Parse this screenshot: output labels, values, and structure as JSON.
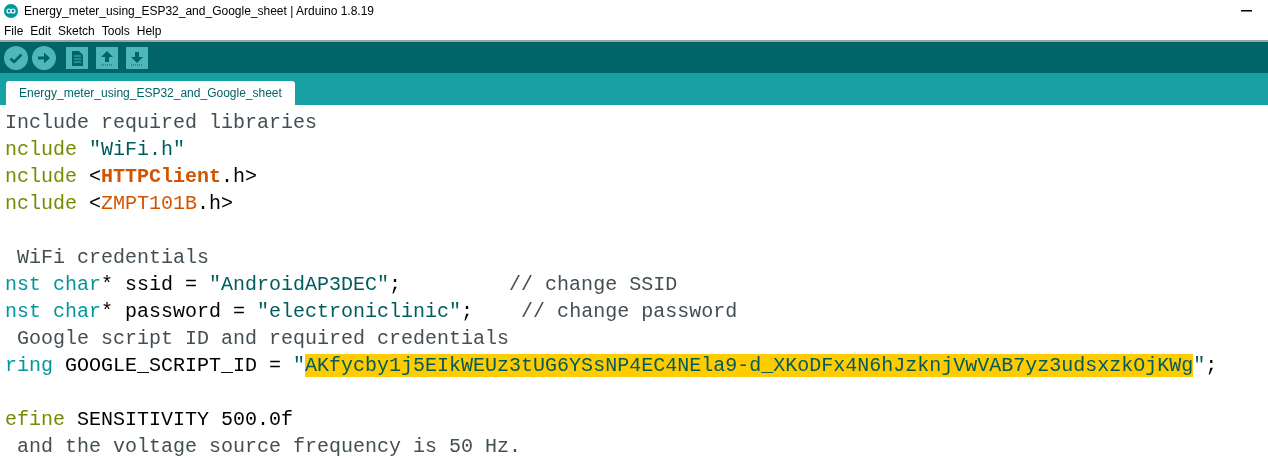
{
  "window": {
    "title": "Energy_meter_using_ESP32_and_Google_sheet | Arduino 1.8.19"
  },
  "menu": [
    "File",
    "Edit",
    "Sketch",
    "Tools",
    "Help"
  ],
  "toolbar": [
    {
      "kind": "verify"
    },
    {
      "kind": "upload"
    },
    {
      "kind": "new"
    },
    {
      "kind": "open"
    },
    {
      "kind": "save"
    }
  ],
  "tabs": [
    {
      "label": "Energy_meter_using_ESP32_and_Google_sheet",
      "selected": true
    }
  ],
  "editor": {
    "lines": [
      {
        "kind": "code",
        "tokens": [
          {
            "kind": "comment",
            "text": "Include required libraries"
          }
        ]
      },
      {
        "kind": "code",
        "tokens": [
          {
            "kind": "directive",
            "text": "nclude"
          },
          {
            "kind": "string",
            "text": " \"WiFi.h\""
          }
        ]
      },
      {
        "kind": "code",
        "tokens": [
          {
            "kind": "directive",
            "text": "nclude"
          },
          {
            "kind": "plain",
            "text": " <"
          },
          {
            "kind": "library_bold",
            "text": "HTTPClient"
          },
          {
            "kind": "plain",
            "text": ".h>"
          }
        ]
      },
      {
        "kind": "code",
        "tokens": [
          {
            "kind": "directive",
            "text": "nclude"
          },
          {
            "kind": "plain",
            "text": " <"
          },
          {
            "kind": "library",
            "text": "ZMPT101B"
          },
          {
            "kind": "plain",
            "text": ".h>"
          }
        ]
      },
      {
        "kind": "blank"
      },
      {
        "kind": "code",
        "tokens": [
          {
            "kind": "comment",
            "text": " WiFi credentials"
          }
        ]
      },
      {
        "kind": "code",
        "tokens": [
          {
            "kind": "type",
            "text": "nst char"
          },
          {
            "kind": "plain",
            "text": "* ssid = "
          },
          {
            "kind": "string",
            "text": "\"AndroidAP3DEC\""
          },
          {
            "kind": "plain",
            "text": ";"
          },
          {
            "kind": "comment",
            "text": "         // change SSID"
          }
        ]
      },
      {
        "kind": "code",
        "tokens": [
          {
            "kind": "type",
            "text": "nst char"
          },
          {
            "kind": "plain",
            "text": "* password = "
          },
          {
            "kind": "string",
            "text": "\"electroniclinic\""
          },
          {
            "kind": "plain",
            "text": ";"
          },
          {
            "kind": "comment",
            "text": "    // change password"
          }
        ]
      },
      {
        "kind": "code",
        "tokens": [
          {
            "kind": "comment",
            "text": " Google script ID and required credentials"
          }
        ]
      },
      {
        "kind": "code",
        "tokens": [
          {
            "kind": "type",
            "text": "ring"
          },
          {
            "kind": "plain",
            "text": " GOOGLE_SCRIPT_ID = "
          },
          {
            "kind": "string",
            "text": "\""
          },
          {
            "kind": "highlight",
            "text": "AKfycby1j5EIkWEUz3tUG6YSsNP4EC4NEla9-d_XKoDFx4N6hJzknjVwVAB7yz3udsxzkOjKWg"
          },
          {
            "kind": "string",
            "text": "\""
          },
          {
            "kind": "plain",
            "text": ";"
          }
        ]
      },
      {
        "kind": "blank"
      },
      {
        "kind": "code",
        "tokens": [
          {
            "kind": "directive",
            "text": "efine"
          },
          {
            "kind": "plain",
            "text": " SENSITIVITY 500.0f"
          }
        ]
      },
      {
        "kind": "code",
        "tokens": [
          {
            "kind": "comment",
            "text": " and the voltage source frequency is 50 Hz."
          }
        ]
      }
    ]
  }
}
